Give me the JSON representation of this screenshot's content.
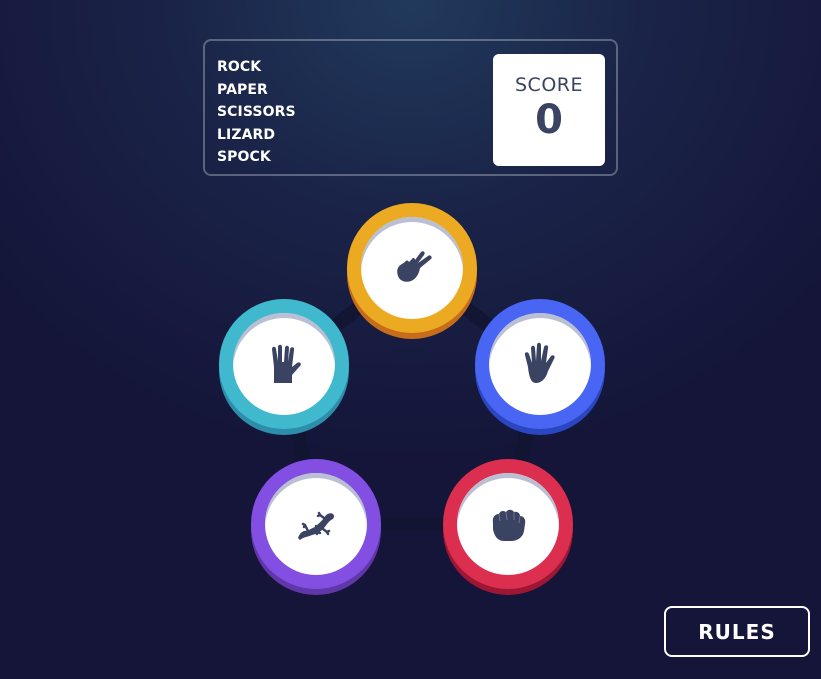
{
  "header": {
    "title_lines": [
      "ROCK",
      "PAPER",
      "SCISSORS",
      "LIZARD",
      "SPOCK"
    ],
    "score_label": "SCORE",
    "score_value": "0"
  },
  "tokens": [
    {
      "id": "scissors",
      "icon": "scissors-hand-icon",
      "color": "#eca922",
      "shadow": "#c76c1b"
    },
    {
      "id": "paper",
      "icon": "paper-hand-icon",
      "color": "#4865f4",
      "shadow": "#2a46c0"
    },
    {
      "id": "rock",
      "icon": "rock-fist-icon",
      "color": "#dc2e4e",
      "shadow": "#9d1634"
    },
    {
      "id": "lizard",
      "icon": "lizard-icon",
      "color": "#834fe3",
      "shadow": "#5f37a8"
    },
    {
      "id": "spock",
      "icon": "spock-hand-icon",
      "color": "#40b9ce",
      "shadow": "#2d8dab"
    }
  ],
  "rules_button": {
    "label": "RULES"
  },
  "colors": {
    "background_dark": "#141539",
    "background_light": "#1f3756",
    "text_dark": "#3b4363",
    "header_outline": "#606e85"
  }
}
